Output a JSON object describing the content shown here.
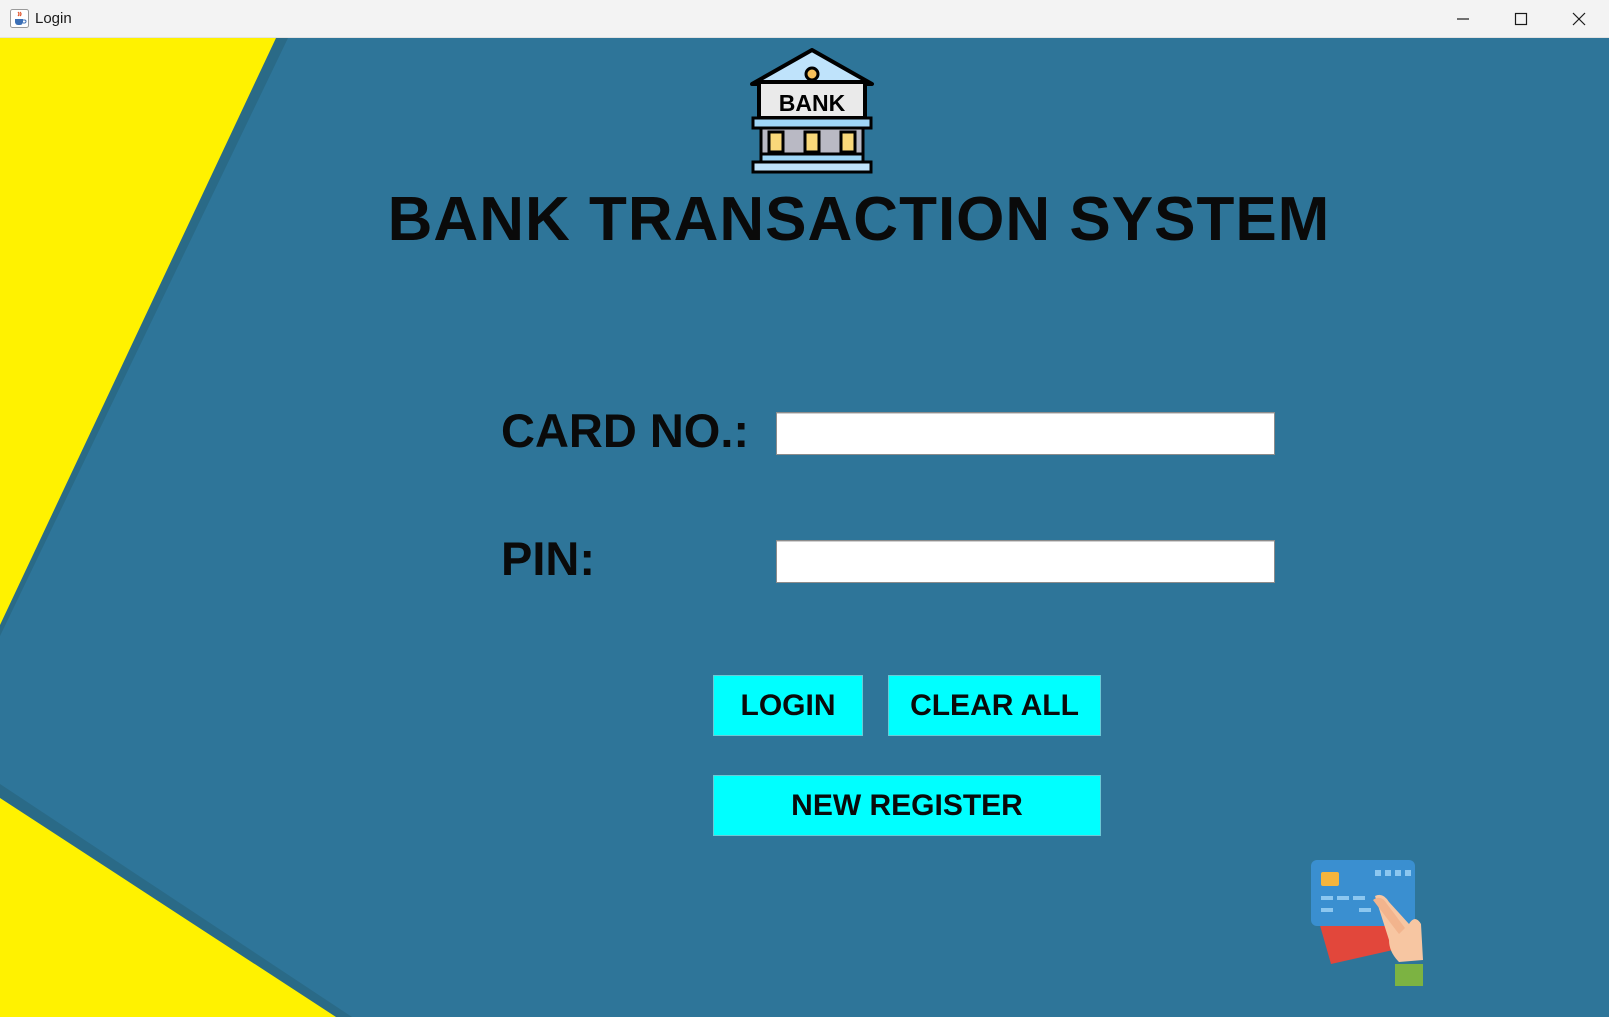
{
  "window": {
    "title": "Login",
    "icon": "java-cup-icon",
    "controls": [
      "minimize-icon",
      "maximize-icon",
      "close-icon"
    ]
  },
  "header": {
    "logo_text": "BANK",
    "title": "BANK TRANSACTION SYSTEM"
  },
  "form": {
    "card_label": "CARD NO.:",
    "card_value": "",
    "pin_label": "PIN:",
    "pin_value": ""
  },
  "buttons": {
    "login": "LOGIN",
    "clear": "CLEAR ALL",
    "register": "NEW REGISTER"
  },
  "colors": {
    "background": "#2e7599",
    "accent_yellow": "#fff200",
    "button": "#00ffff"
  }
}
